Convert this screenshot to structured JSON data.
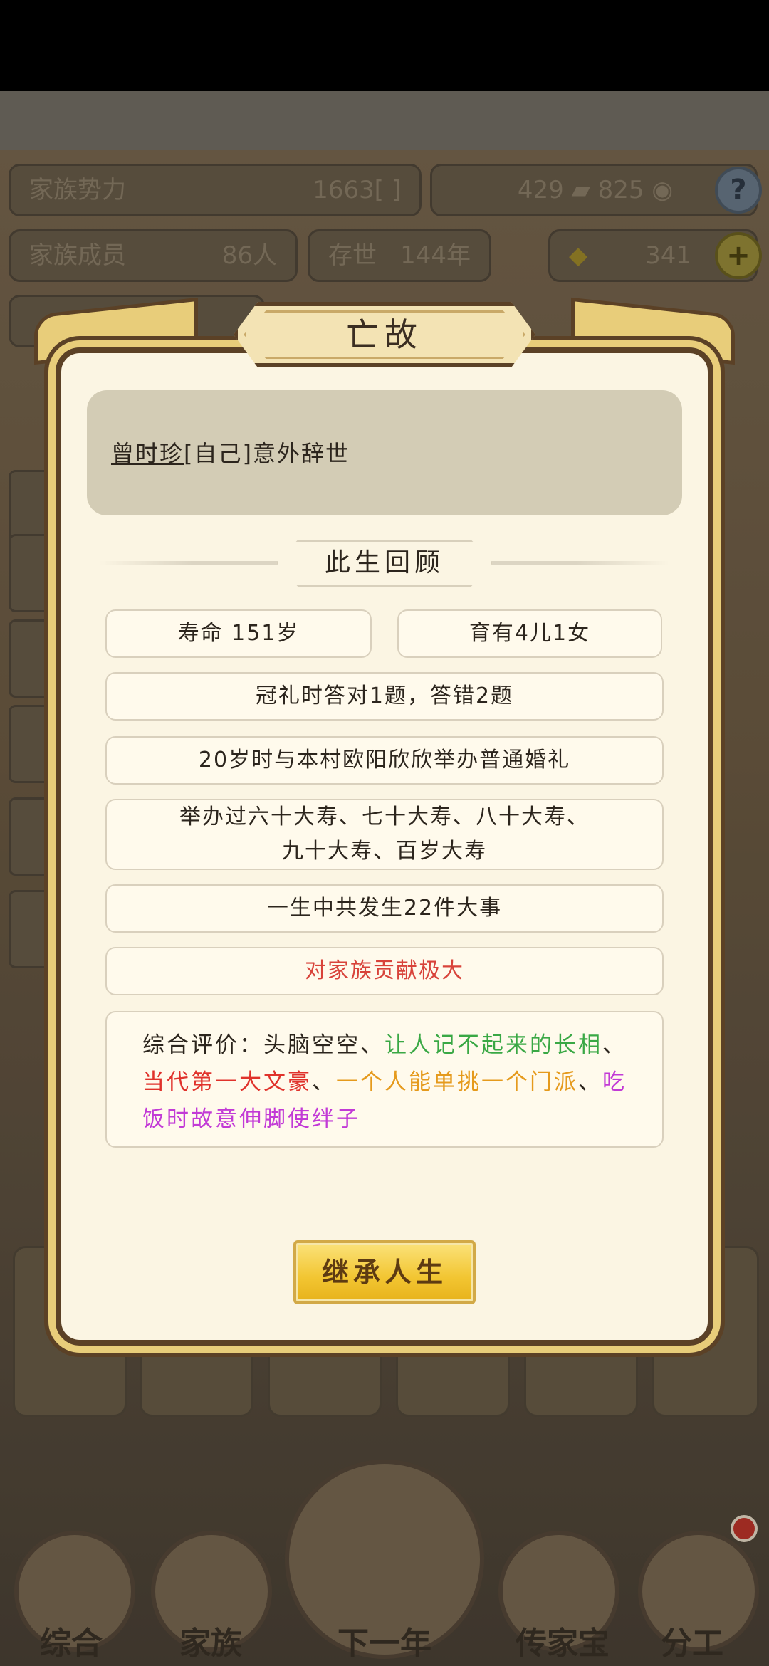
{
  "background": {
    "clan_power_label": "家族势力",
    "clan_power_value": "1663[ ]",
    "currency_a": "429",
    "currency_b": "825",
    "clan_members_label": "家族成员",
    "clan_members_value": "86人",
    "existence_label": "存世",
    "existence_value": "144年",
    "gold_value": "341",
    "help_icon_glyph": "?",
    "plus_icon_glyph": "+"
  },
  "nav": {
    "items": [
      {
        "label": "综合"
      },
      {
        "label": "家族"
      },
      {
        "label": "下一年"
      },
      {
        "label": "传家宝"
      },
      {
        "label": "分工"
      }
    ]
  },
  "dialog": {
    "title": "亡故",
    "death_name": "曾时珍",
    "death_text": "[自己]意外辞世",
    "section_title": "此生回顾",
    "lifespan": "寿命 151岁",
    "children": "育有4儿1女",
    "coming_of_age": "冠礼时答对1题，答错2题",
    "marriage": "20岁时与本村欧阳欣欣举办普通婚礼",
    "birthdays_line1": "举办过六十大寿、七十大寿、八十大寿、",
    "birthdays_line2": "九十大寿、百岁大寿",
    "events": "一生中共发生22件大事",
    "contribution": "对家族贡献极大",
    "evaluation": {
      "prefix": "综合评价：头脑空空、",
      "trait1": "让人记不起来的长相",
      "sep1": "、",
      "trait2": "当代第一大文豪",
      "sep2": "、",
      "trait3": "一个人能单挑一个门派",
      "sep3": "、",
      "trait4": "吃饭时故意伸脚使绊子"
    },
    "inherit_button": "继承人生"
  },
  "colors": {
    "trait_green": "#3aa845",
    "trait_red": "#e0322b",
    "trait_orange": "#e59a1c",
    "trait_purple": "#c23ad6",
    "frame_gold": "#e8cd7a",
    "frame_brown": "#5b4126"
  }
}
